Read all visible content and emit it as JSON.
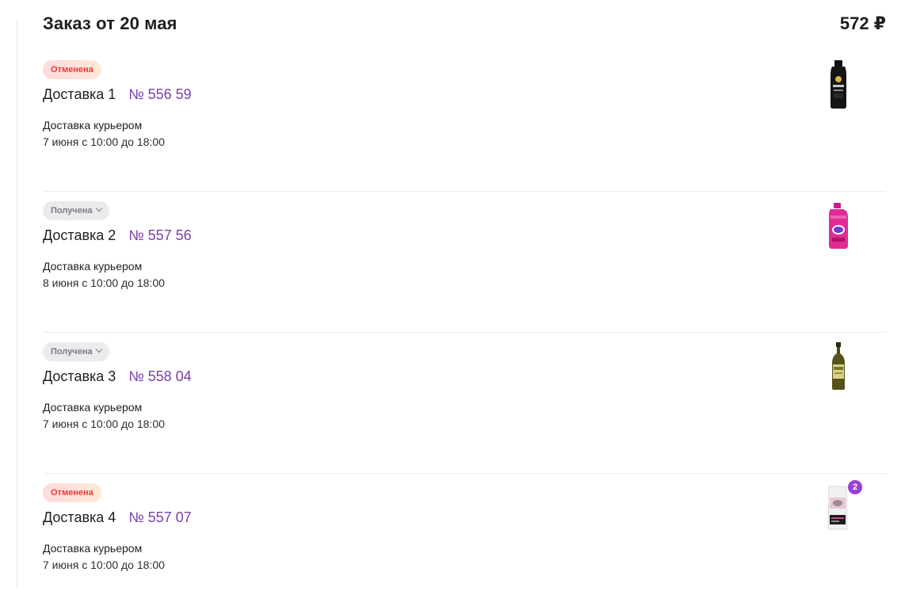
{
  "order": {
    "title": "Заказ от 20 мая",
    "total": "572 ₽"
  },
  "deliveries": [
    {
      "status": "Отменена",
      "status_type": "cancelled",
      "title": "Доставка 1",
      "number": "№ 556 59",
      "method": "Доставка курьером",
      "time": "7 июня с 10:00 до 18:00",
      "product_icon": "shampoo-bottle-icon"
    },
    {
      "status": "Получена",
      "status_type": "received",
      "title": "Доставка 2",
      "number": "№ 557 56",
      "method": "Доставка курьером",
      "time": "8 июня с 10:00 до 18:00",
      "product_icon": "stain-remover-bottle-icon"
    },
    {
      "status": "Получена",
      "status_type": "received",
      "title": "Доставка 3",
      "number": "№ 558 04",
      "method": "Доставка курьером",
      "time": "7 июня с 10:00 до 18:00",
      "product_icon": "olive-oil-bottle-icon"
    },
    {
      "status": "Отменена",
      "status_type": "cancelled",
      "title": "Доставка 4",
      "number": "№ 557 07",
      "method": "Доставка курьером",
      "time": "7 июня с 10:00 до 18:00",
      "product_icon": "cat-food-pack-icon",
      "quantity": "2"
    }
  ],
  "colors": {
    "accent_purple": "#7b3fa8",
    "cancelled_text": "#e23b3b",
    "received_bg": "#ebebee",
    "qty_badge": "#9b3fd6"
  }
}
